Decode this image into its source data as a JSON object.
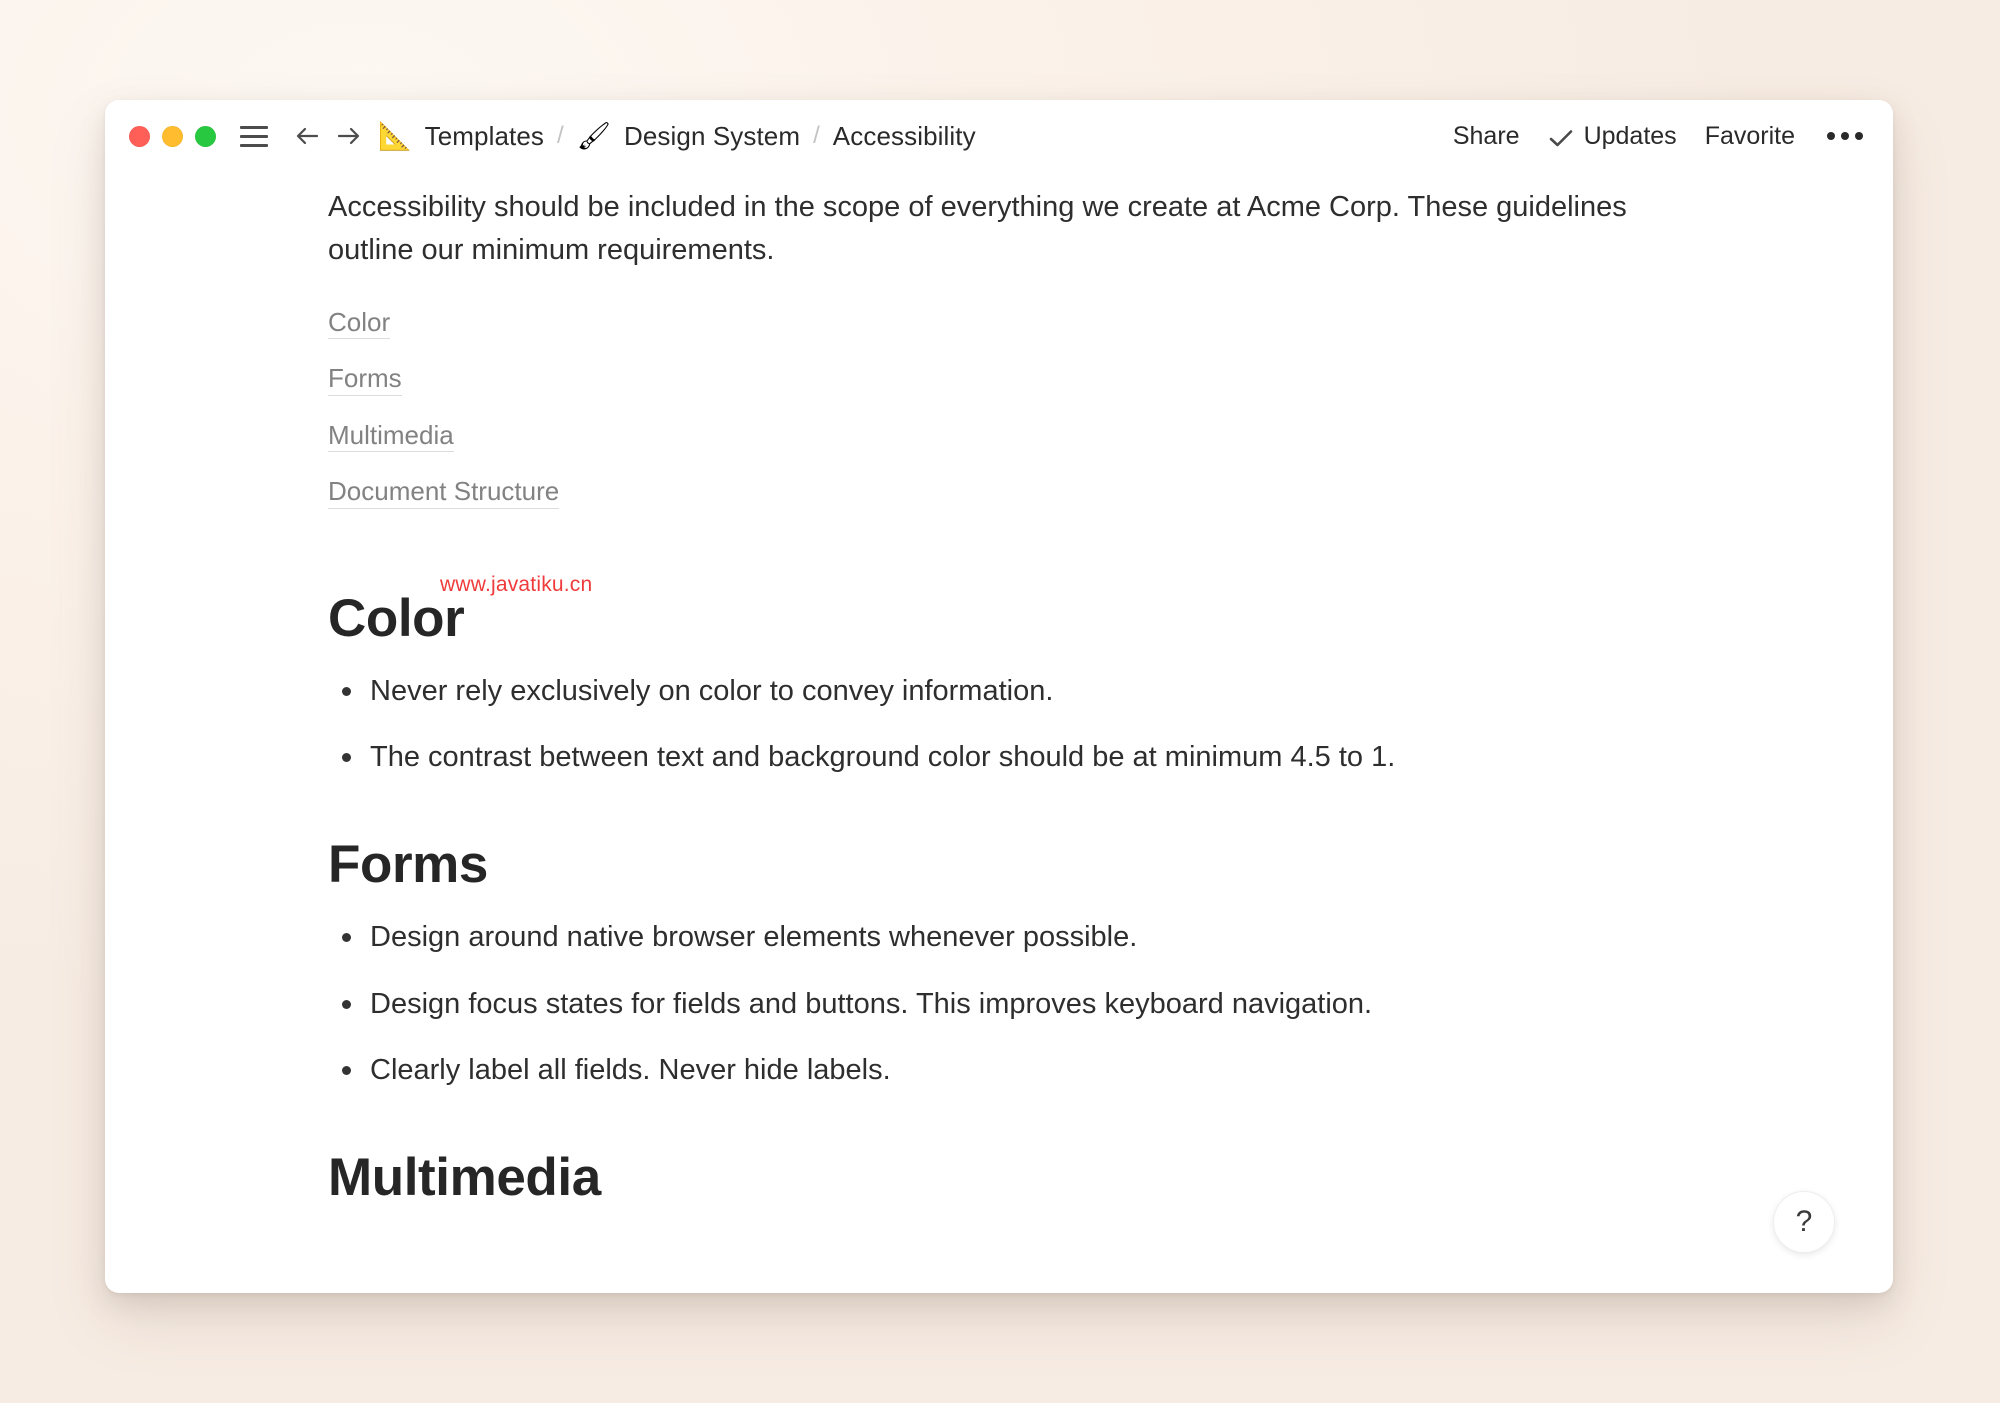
{
  "background_color": "#fcf4ee",
  "window": {
    "traffic_lights": [
      {
        "name": "close",
        "color": "#ff5f57"
      },
      {
        "name": "minimize",
        "color": "#febc2e"
      },
      {
        "name": "maximize",
        "color": "#28c840"
      }
    ],
    "toolbar": {
      "menu_icon": "hamburger-icon",
      "back_icon": "arrow-left-icon",
      "forward_icon": "arrow-right-icon",
      "breadcrumb": [
        {
          "emoji": "📐",
          "emoji_name": "triangular-ruler-icon",
          "label": "Templates"
        },
        {
          "emoji": "🖌",
          "emoji_name": "paintbrush-icon",
          "label": "Design System"
        },
        {
          "emoji": "",
          "emoji_name": "",
          "label": "Accessibility"
        }
      ],
      "separator": "/",
      "actions": {
        "share": "Share",
        "updates": "Updates",
        "updates_icon": "check-icon",
        "favorite": "Favorite",
        "overflow_icon": "ellipsis-icon"
      }
    }
  },
  "document": {
    "intro": "Accessibility should be included in the scope of everything we create at Acme Corp. These guidelines outline our minimum requirements.",
    "toc": [
      {
        "label": "Color"
      },
      {
        "label": "Forms"
      },
      {
        "label": "Multimedia"
      },
      {
        "label": "Document Structure"
      }
    ],
    "sections": [
      {
        "heading": "Color",
        "bullets": [
          "Never rely exclusively on color to convey information.",
          "The contrast between text and background color should be at minimum 4.5 to 1."
        ]
      },
      {
        "heading": "Forms",
        "bullets": [
          "Design around native browser elements whenever possible.",
          "Design focus states for fields and buttons. This improves keyboard navigation.",
          "Clearly label all fields. Never hide labels."
        ]
      },
      {
        "heading": "Multimedia",
        "bullets": []
      }
    ]
  },
  "watermark": {
    "text": "www.javatiku.cn",
    "color": "#ef3b3b"
  },
  "help_button": {
    "label": "?"
  }
}
